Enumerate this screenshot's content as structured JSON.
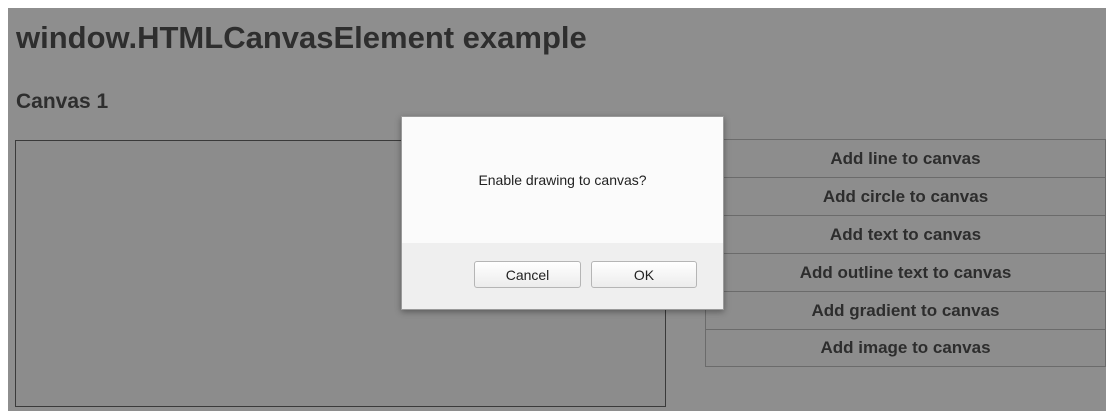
{
  "page": {
    "title": "window.HTMLCanvasElement example",
    "section_title": "Canvas 1"
  },
  "buttons": [
    {
      "label": "Add line to canvas"
    },
    {
      "label": "Add circle to canvas"
    },
    {
      "label": "Add text to canvas"
    },
    {
      "label": "Add outline text to canvas"
    },
    {
      "label": "Add gradient to canvas"
    },
    {
      "label": "Add image to canvas"
    }
  ],
  "dialog": {
    "message": "Enable drawing to canvas?",
    "cancel_label": "Cancel",
    "ok_label": "OK"
  },
  "colors": {
    "overlay_background": "#8e8e8e",
    "dialog_background": "#f6f6f6"
  }
}
